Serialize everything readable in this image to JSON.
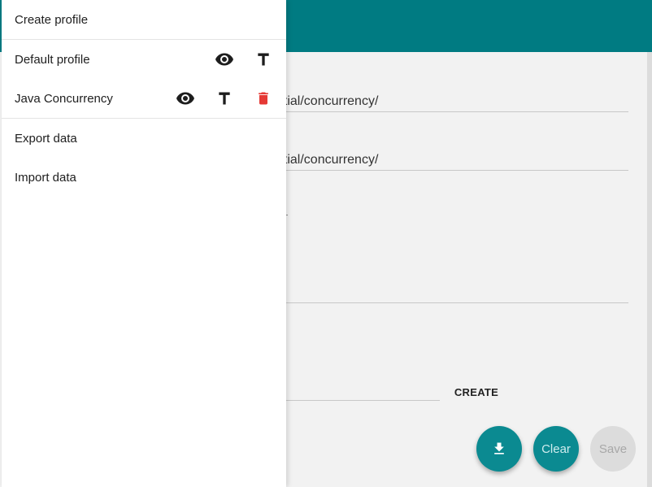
{
  "drawer": {
    "create_profile": "Create profile",
    "profiles": [
      {
        "name": "Default profile",
        "icons": [
          "eye-icon",
          "text-format-icon"
        ]
      },
      {
        "name": "Java Concurrency",
        "icons": [
          "eye-icon",
          "text-format-icon",
          "delete-icon"
        ]
      }
    ],
    "export": "Export data",
    "import": "Import data"
  },
  "main": {
    "field1_value_visible": "ntial/concurrency/",
    "field2_value_visible": "ntial/concurrency/",
    "create_button": "CREATE"
  },
  "fabs": {
    "download_icon": "download-icon",
    "clear": "Clear",
    "save": "Save"
  },
  "colors": {
    "app_bar": "#007b82",
    "fab": "#0b8a91",
    "delete": "#e53935"
  }
}
